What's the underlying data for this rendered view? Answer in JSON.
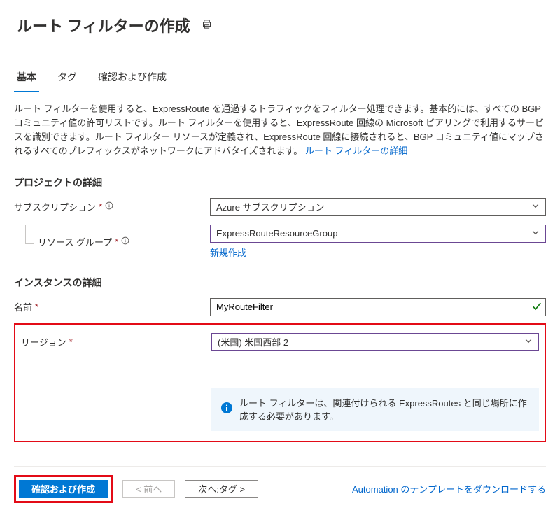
{
  "header": {
    "title": "ルート フィルターの作成"
  },
  "tabs": {
    "basic": "基本",
    "tags": "タグ",
    "review": "確認および作成"
  },
  "description": {
    "text": "ルート フィルターを使用すると、ExpressRoute を通過するトラフィックをフィルター処理できます。基本的には、すべての BGP コミュニティ値の許可リストです。ルート フィルターを使用すると、ExpressRoute 回線の Microsoft ピアリングで利用するサービスを識別できます。ルート フィルター リソースが定義され、ExpressRoute 回線に接続されると、BGP コミュニティ値にマップされるすべてのプレフィックスがネットワークにアドバタイズされます。",
    "link_text": "ルート フィルターの詳細"
  },
  "project": {
    "heading": "プロジェクトの詳細",
    "subscription_label": "サブスクリプション",
    "subscription_value": "Azure サブスクリプション",
    "resource_group_label": "リソース グループ",
    "resource_group_value": "ExpressRouteResourceGroup",
    "new_link": "新規作成"
  },
  "instance": {
    "heading": "インスタンスの詳細",
    "name_label": "名前",
    "name_value": "MyRouteFilter",
    "region_label": "リージョン",
    "region_value": "(米国) 米国西部 2"
  },
  "info_banner": {
    "message": "ルート フィルターは、関連付けられる ExpressRoutes と同じ場所に作成する必要があります。"
  },
  "footer": {
    "review_create": "確認および作成",
    "previous": "< 前へ",
    "next": "次へ:タグ >",
    "download_link": "Automation のテンプレートをダウンロードする"
  }
}
